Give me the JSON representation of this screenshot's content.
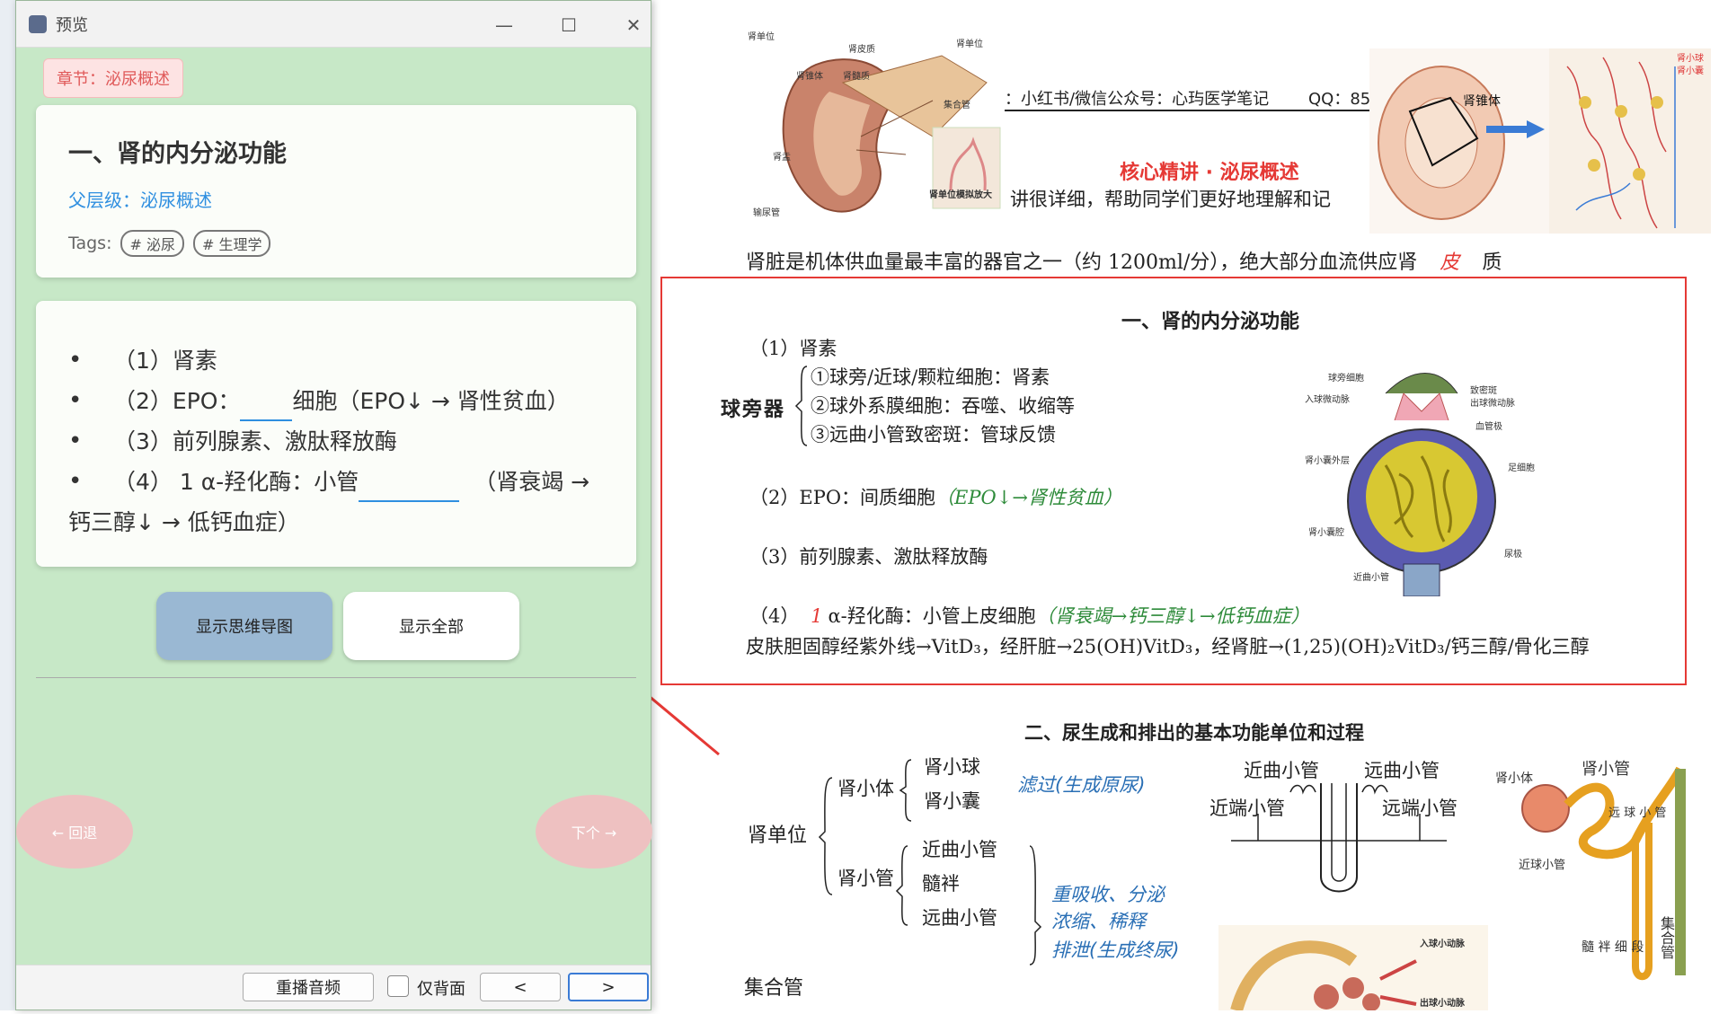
{
  "window": {
    "title": "预览",
    "minimize": "—",
    "maximize": "☐",
    "close": "✕"
  },
  "card": {
    "chapter": "章节：泌尿概述",
    "heading": "一、肾的内分泌功能",
    "parent": "父层级：泌尿概述",
    "tags_label": "Tags:",
    "tags": [
      "# 泌尿",
      "# 生理学"
    ],
    "items": [
      "（1）肾素",
      "（2）EPO：",
      "（3）前列腺素、激肽释放酶",
      "（4） 1 α-羟化酶：小管"
    ],
    "item2_tail": "细胞（EPO↓ → 肾性贫血）",
    "item4_tail": "（肾衰竭 →",
    "item4_cont": "钙三醇↓ → 低钙血症）"
  },
  "buttons": {
    "mindmap": "显示思维导图",
    "show_all": "显示全部",
    "prev": "← 回退",
    "next": "下个 →",
    "replay": "重播音频",
    "back_only": "仅背面",
    "lt": "<",
    "gt": ">"
  },
  "doc": {
    "header_contact": "：小红书/微信公众号：心玙医学笔记",
    "header_qq": "QQ：85",
    "core_title": "核心精讲 · 泌尿概述",
    "intro_fragment": "讲很详细，帮助同学们更好地理解和记",
    "blood_line": "肾脏是机体供血量最丰富的器官之一（约 1200ml/分），绝大部分血流供应肾",
    "blood_red": "皮",
    "blood_end": "质",
    "sec1_title": "一、肾的内分泌功能",
    "renin": "（1）肾素",
    "jga": "球旁器",
    "jga_1": "①球旁/近球/颗粒细胞：肾素",
    "jga_2": "②球外系膜细胞：吞噬、收缩等",
    "jga_3": "③远曲小管致密斑：管球反馈",
    "epo": "（2）EPO：间质细胞",
    "epo_note": "（EPO↓→肾性贫血）",
    "pg": "（3）前列腺素、激肽释放酶",
    "hydrox": "（4）",
    "hydrox_i": "1",
    "hydrox_main": "α-羟化酶：小管上皮细胞",
    "hydrox_note": "（肾衰竭→钙三醇↓→低钙血症）",
    "vitd": "皮肤胆固醇经紫外线→VitD₃，经肝脏→25(OH)VitD₃，经肾脏→(1,25)(OH)₂VitD₃/钙三醇/骨化三醇",
    "sec2_title": "二、尿生成和排出的基本功能单位和过程",
    "nephron": "肾单位",
    "corpuscle": "肾小体",
    "glomerulus": "肾小球",
    "capsule": "肾小囊",
    "filtration": "滤过(生成原尿)",
    "tubule": "肾小管",
    "pct": "近曲小管",
    "loop": "髓袢",
    "dct": "远曲小管",
    "reabs_1": "重吸收、分泌",
    "reabs_2": "浓缩、稀释",
    "reabs_3": "排泄(生成终尿)",
    "collecting": "集合管",
    "d_pct1": "近曲小管",
    "d_dct1": "远曲小管",
    "d_prox1": "近端小管",
    "d_prox2": "远端小管",
    "fig_labels": {
      "nephron_pos": "肾单位",
      "cortex": "肾皮质",
      "nephron2": "肾单位",
      "pyramid": "肾锥体",
      "medulla": "肾髓质",
      "collecting": "集合管",
      "pelvis": "肾盂",
      "ureter": "输尿管",
      "model": "肾单位模拟放大",
      "glom_cell": "球旁细胞",
      "aff": "入球微动脉",
      "macula": "致密斑",
      "eff": "出球微动脉",
      "vessel": "血管极",
      "outer": "肾小囊外层",
      "podo": "足细胞",
      "cavity": "肾小囊腔",
      "urinary": "尿极",
      "pct_small": "近曲小管",
      "renal_body": "肾小体",
      "renal_tubule": "肾小管",
      "distal": "远 球 小 管",
      "proximal": "近球小管",
      "collect_v": "集合管",
      "thin_seg": "髓 袢 细 段",
      "aff2": "入球小动脉",
      "eff2": "出球小动脉",
      "pyramid2": "肾锥体",
      "glom_tr": "肾小球",
      "caps_tr": "肾小囊"
    }
  },
  "colors": {
    "window_bg": "#c7e8c7",
    "accent_blue": "#2f8fe0",
    "chapter_red": "#e05a5a",
    "doc_red": "#e53935",
    "doc_green": "#2e8b3a",
    "doc_blue": "#2a6fb5"
  }
}
